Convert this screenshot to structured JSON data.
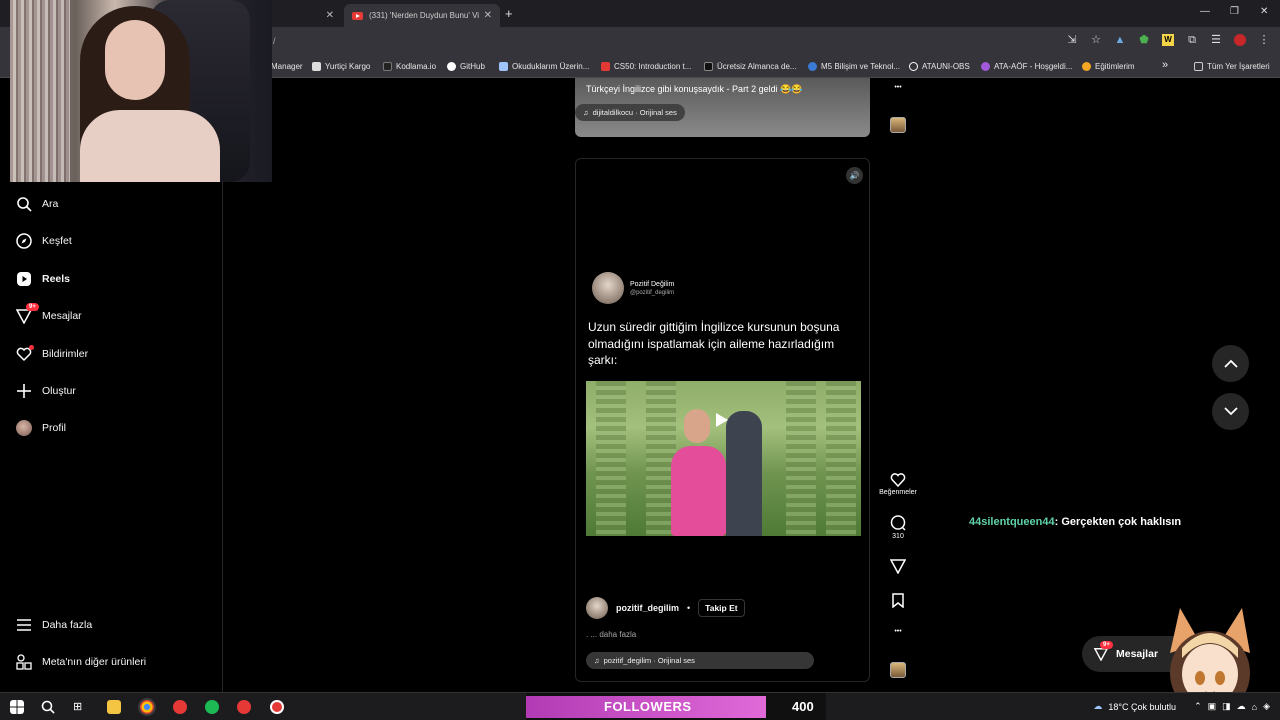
{
  "browser": {
    "tabs": [
      {
        "label": ""
      },
      {
        "label": "(331) 'Nerden Duydun Bunu' Vi"
      }
    ],
    "address_text": "/",
    "bookmarks": [
      {
        "label": "Manager",
        "color": "#cccccc"
      },
      {
        "label": "Yurtiçi Kargo",
        "color": "#dddddd"
      },
      {
        "label": "Kodlama.io",
        "color": "#222222"
      },
      {
        "label": "GitHub",
        "color": "#ffffff"
      },
      {
        "label": "Okuduklarım Üzerin...",
        "color": "#a0c4ff"
      },
      {
        "label": "CS50: Introduction t...",
        "color": "#e53935"
      },
      {
        "label": "Ücretsiz Almanca de...",
        "color": "#111111"
      },
      {
        "label": "M5 Bilişim ve Teknol...",
        "color": "#3a7bd5"
      },
      {
        "label": "ATAUNI-OBS",
        "color": "#ffffff"
      },
      {
        "label": "ATA-AÖF - Hoşgeldi...",
        "color": "#a259d9"
      },
      {
        "label": "Eğitimlerim",
        "color": "#f5a623"
      }
    ],
    "bookmarks_more": "»",
    "all_bookmarks": "Tüm Yer İşaretleri"
  },
  "nav": {
    "items": [
      {
        "label": "Ara",
        "icon": "search-icon"
      },
      {
        "label": "Keşfet",
        "icon": "compass-icon"
      },
      {
        "label": "Reels",
        "icon": "reels-icon"
      },
      {
        "label": "Mesajlar",
        "icon": "messenger-icon",
        "badge": "9+"
      },
      {
        "label": "Bildirimler",
        "icon": "heart-icon"
      },
      {
        "label": "Oluştur",
        "icon": "plus-icon"
      },
      {
        "label": "Profil",
        "icon": "avatar"
      }
    ],
    "more": "Daha fazla",
    "meta": "Meta'nın diğer ürünleri"
  },
  "prev_post": {
    "caption": "Türkçeyi İngilizce gibi konuşsaydık - Part 2 geldi 😂😂",
    "audio": "dijitaldilkocu · Orijinal ses"
  },
  "reel": {
    "tweet_name": "Pozitif Değilim",
    "tweet_handle": "@pozitif_degilim",
    "tweet_text": "Uzun süredir gittiğim İngilizce kursunun  boşuna olmadığını ispatlamak için aileme hazırladığım şarkı:",
    "author": "pozitif_degilim",
    "follow": "Takip Et",
    "separator": "•",
    "more": ". ... daha fazla",
    "audio": "pozitif_degilim · Orijinal ses",
    "likes_label": "Beğenmeler",
    "comments": "310"
  },
  "overlay": {
    "chat_user": "44silentqueen44",
    "chat_text": ": Gerçekten çok haklısın",
    "messages_label": "Mesajlar",
    "messages_badge": "9+",
    "followers_label": "FOLLOWERS",
    "followers_count": "400",
    "followers_progress": 0.8
  },
  "taskbar": {
    "weather": "18°C  Çok bulutlu"
  }
}
